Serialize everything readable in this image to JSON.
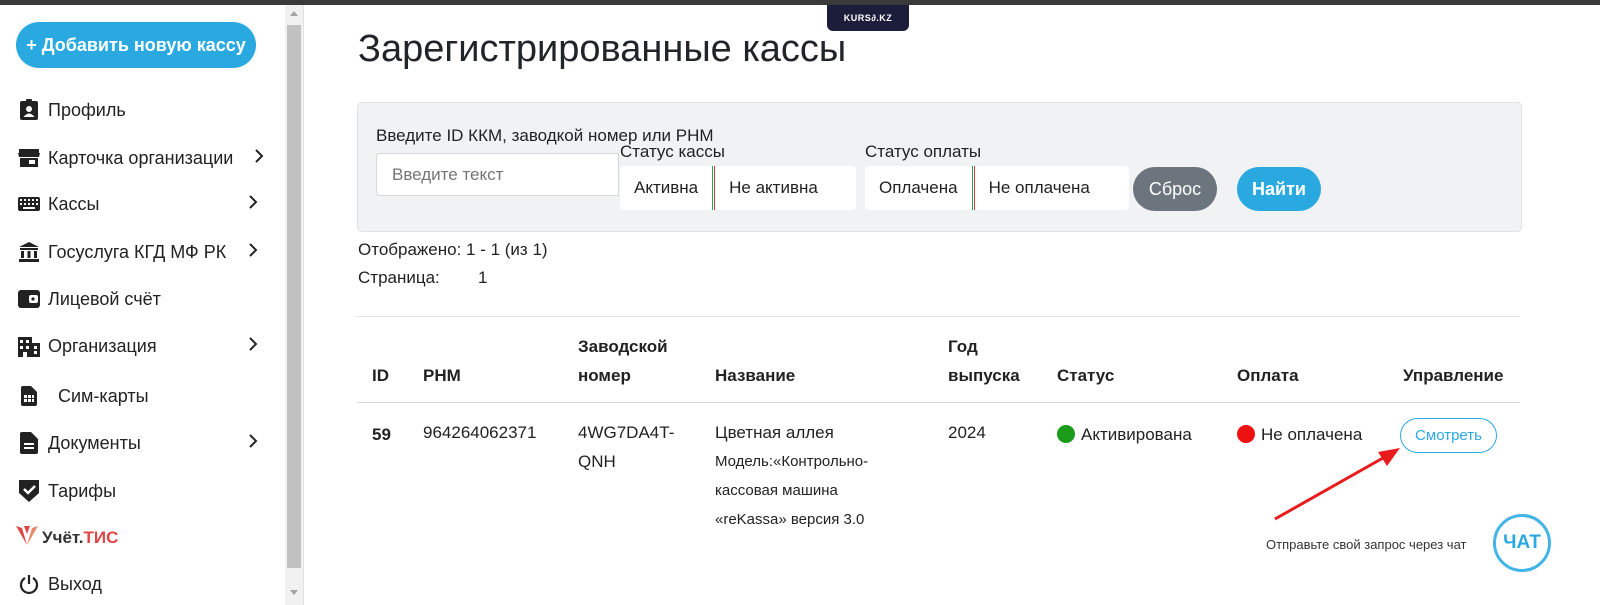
{
  "sidebar": {
    "add_button": "+ Добавить новую кассу",
    "items": [
      {
        "label": "Профиль",
        "icon": "profile-icon",
        "chevron": false
      },
      {
        "label": "Карточка организации",
        "icon": "store-icon",
        "chevron": true
      },
      {
        "label": "Кассы",
        "icon": "keyboard-icon",
        "chevron": true
      },
      {
        "label": "Госуслуга КГД МФ РК",
        "icon": "bank-icon",
        "chevron": true
      },
      {
        "label": "Лицевой счёт",
        "icon": "wallet-icon",
        "chevron": false
      },
      {
        "label": "Организация",
        "icon": "building-icon",
        "chevron": true
      },
      {
        "label": "Сим-карты",
        "icon": "sim-icon",
        "chevron": false
      },
      {
        "label": "Документы",
        "icon": "document-icon",
        "chevron": true
      },
      {
        "label": "Тарифы",
        "icon": "shield-check-icon",
        "chevron": false
      },
      {
        "label": "Выход",
        "icon": "power-icon",
        "chevron": false
      }
    ],
    "logo": {
      "part1": "Учёт.",
      "part2": "ТИС"
    }
  },
  "top_badge": "KURS∂.KZ",
  "page": {
    "title": "Зарегистрированные кассы"
  },
  "filters": {
    "search_label": "Введите ID ККМ, заводкой номер или РНМ",
    "search_placeholder": "Введите текст",
    "status_label": "Статус кассы",
    "status_options": [
      "Активна",
      "Не активна"
    ],
    "payment_label": "Статус оплаты",
    "payment_options": [
      "Оплачена",
      "Не оплачена"
    ],
    "reset": "Сброс",
    "find": "Найти"
  },
  "results": {
    "shown": "Отображено: 1 - 1 (из 1)",
    "page_label": "Страница:",
    "page_number": "1"
  },
  "table": {
    "headers": {
      "id": "ID",
      "rnm": "РНМ",
      "serial_1": "Заводской",
      "serial_2": "номер",
      "name": "Название",
      "year_1": "Год",
      "year_2": "выпуска",
      "status": "Статус",
      "payment": "Оплата",
      "manage": "Управление"
    },
    "row": {
      "id": "59",
      "rnm": "964264062371",
      "serial_1": "4WG7DA4T-",
      "serial_2": "QNH",
      "name": "Цветная аллея",
      "model_1": "Модель:«Контрольно-",
      "model_2": "кассовая машина",
      "model_3": "«reKassa» версия 3.0",
      "year": "2024",
      "status": "Активирована",
      "status_color": "#1a9c1a",
      "payment": "Не оплачена",
      "payment_color": "#ee1111",
      "action": "Смотреть"
    }
  },
  "chat": {
    "hint": "Отправьте свой запрос через чат",
    "button": "ЧАТ"
  },
  "colors": {
    "accent": "#2aa9e0",
    "reset": "#6c757d",
    "arrow": "#e81c1c"
  }
}
